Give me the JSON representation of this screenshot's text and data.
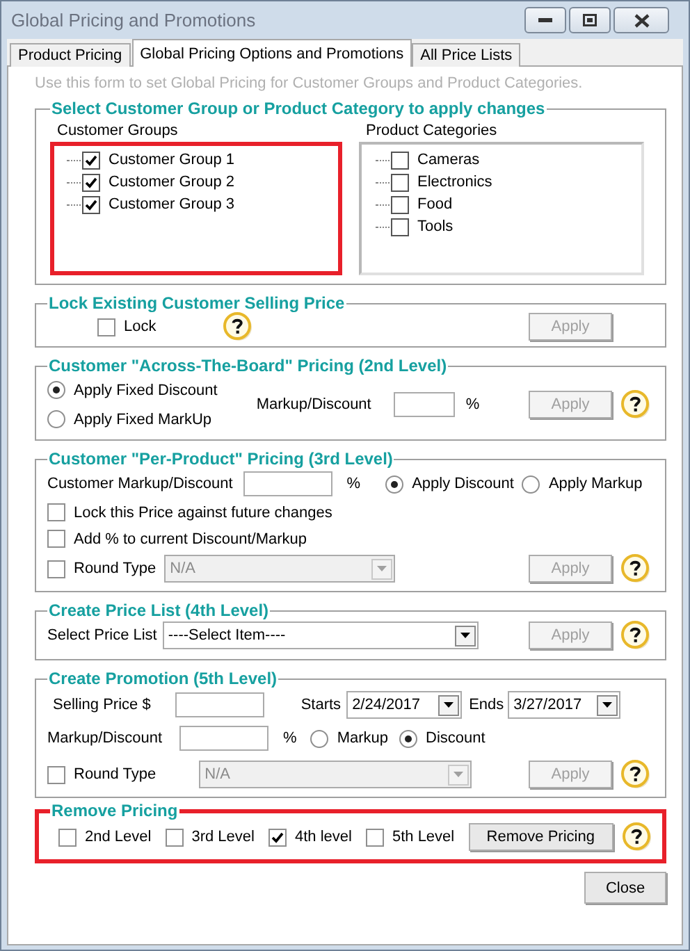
{
  "window": {
    "title": "Global Pricing and Promotions"
  },
  "tabs": [
    {
      "label": "Product Pricing",
      "selected": false
    },
    {
      "label": "Global Pricing Options and Promotions",
      "selected": true
    },
    {
      "label": "All Price Lists",
      "selected": false
    }
  ],
  "hint": "Use this form to set Global Pricing for Customer Groups and Product Categories.",
  "select_group": {
    "title": "Select Customer Group or Product Category to apply changes",
    "customer_groups": {
      "label": "Customer Groups",
      "highlighted": true,
      "items": [
        {
          "label": "Customer Group 1",
          "checked": true
        },
        {
          "label": "Customer Group 2",
          "checked": true
        },
        {
          "label": "Customer Group 3",
          "checked": true
        }
      ]
    },
    "product_categories": {
      "label": "Product Categories",
      "highlighted": false,
      "items": [
        {
          "label": "Cameras",
          "checked": false
        },
        {
          "label": "Electronics",
          "checked": false
        },
        {
          "label": "Food",
          "checked": false
        },
        {
          "label": "Tools",
          "checked": false
        }
      ]
    }
  },
  "lock_section": {
    "title": "Lock Existing Customer Selling Price",
    "lock": {
      "label": "Lock",
      "checked": false
    },
    "apply": {
      "label": "Apply",
      "disabled": true
    }
  },
  "across_board": {
    "title": "Customer \"Across-The-Board\" Pricing (2nd Level)",
    "options": [
      {
        "label": "Apply Fixed Discount",
        "selected": true
      },
      {
        "label": "Apply Fixed MarkUp",
        "selected": false
      }
    ],
    "markup_label": "Markup/Discount",
    "percent": "%",
    "apply": {
      "label": "Apply",
      "disabled": true
    }
  },
  "per_product": {
    "title": "Customer \"Per-Product\" Pricing (3rd Level)",
    "markup_label": "Customer Markup/Discount",
    "percent": "%",
    "options": [
      {
        "label": "Apply Discount",
        "selected": true
      },
      {
        "label": "Apply Markup",
        "selected": false
      }
    ],
    "checkboxes": [
      {
        "label": "Lock this Price against future changes",
        "checked": false
      },
      {
        "label": "Add % to current Discount/Markup",
        "checked": false
      }
    ],
    "round_type": {
      "label": "Round Type",
      "checked": false,
      "value": "N/A",
      "disabled": true
    },
    "apply": {
      "label": "Apply",
      "disabled": true
    }
  },
  "price_list": {
    "title": "Create Price List (4th Level)",
    "label": "Select Price List",
    "value": "----Select Item----",
    "apply": {
      "label": "Apply",
      "disabled": true
    }
  },
  "promotion": {
    "title": "Create Promotion (5th Level)",
    "selling_price_label": "Selling Price $",
    "starts_label": "Starts",
    "starts": "2/24/2017",
    "ends_label": "Ends",
    "ends": "3/27/2017",
    "markup_label": "Markup/Discount",
    "percent": "%",
    "options": [
      {
        "label": "Markup",
        "selected": false
      },
      {
        "label": "Discount",
        "selected": true
      }
    ],
    "round_type": {
      "label": "Round Type",
      "checked": false,
      "value": "N/A",
      "disabled": true
    },
    "apply": {
      "label": "Apply",
      "disabled": true
    }
  },
  "remove_pricing": {
    "title": "Remove Pricing",
    "highlighted": true,
    "levels": [
      {
        "label": "2nd Level",
        "checked": false
      },
      {
        "label": "3rd Level",
        "checked": false
      },
      {
        "label": "4th level",
        "checked": true
      },
      {
        "label": "5th Level",
        "checked": false
      }
    ],
    "button": {
      "label": "Remove Pricing",
      "disabled": false
    }
  },
  "close": {
    "label": "Close"
  }
}
